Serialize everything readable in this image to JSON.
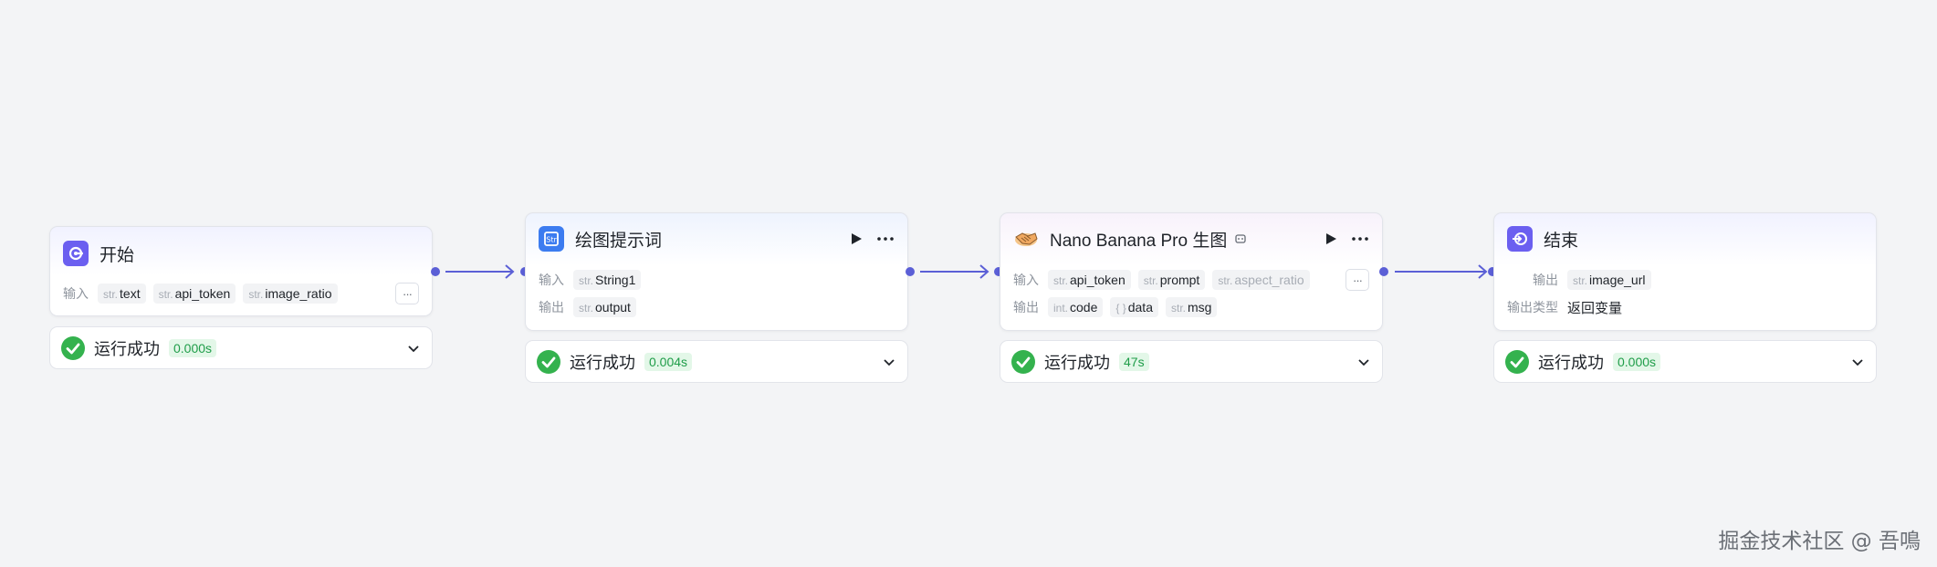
{
  "nodes": {
    "start": {
      "title": "开始",
      "input_label": "输入",
      "inputs": [
        {
          "type": "str.",
          "name": "text"
        },
        {
          "type": "str.",
          "name": "api_token"
        },
        {
          "type": "str.",
          "name": "image_ratio"
        }
      ],
      "status_label": "运行成功",
      "status_time": "0.000s"
    },
    "prompt": {
      "title": "绘图提示词",
      "input_label": "输入",
      "output_label": "输出",
      "inputs": [
        {
          "type": "str.",
          "name": "String1"
        }
      ],
      "outputs": [
        {
          "type": "str.",
          "name": "output"
        }
      ],
      "status_label": "运行成功",
      "status_time": "0.004s"
    },
    "banana": {
      "title": "Nano Banana Pro 生图",
      "input_label": "输入",
      "output_label": "输出",
      "inputs": [
        {
          "type": "str.",
          "name": "api_token"
        },
        {
          "type": "str.",
          "name": "prompt"
        },
        {
          "type": "str.",
          "name": "aspect_ratio"
        }
      ],
      "outputs": [
        {
          "type": "int.",
          "name": "code"
        },
        {
          "type": "{ }",
          "name": "data"
        },
        {
          "type": "str.",
          "name": "msg"
        }
      ],
      "status_label": "运行成功",
      "status_time": "47s"
    },
    "end": {
      "title": "结束",
      "output_label": "输出",
      "output_type_label": "输出类型",
      "outputs": [
        {
          "type": "str.",
          "name": "image_url"
        }
      ],
      "output_type_value": "返回变量",
      "status_label": "运行成功",
      "status_time": "0.000s"
    }
  },
  "more_label": "···",
  "watermark": "掘金技术社区 @ 吾鳴",
  "colors": {
    "accent": "#5b5fd6",
    "success": "#34b24e",
    "start_icon": "#6b5ff0",
    "prompt_icon": "#3c7cf0",
    "end_icon": "#6b5ff0"
  }
}
